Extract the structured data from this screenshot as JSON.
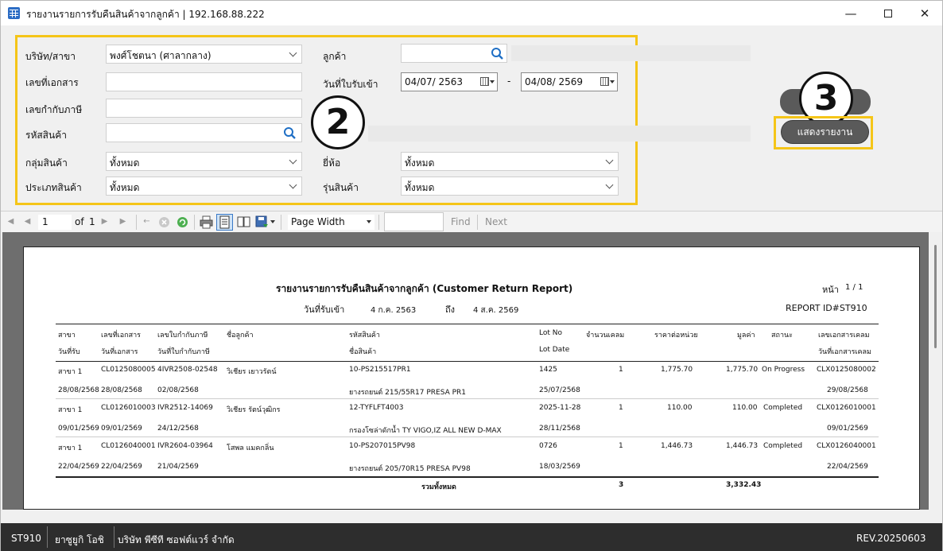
{
  "window": {
    "title": "รายงานรายการรับคืนสินค้าจากลูกค้า | 192.168.88.222"
  },
  "form": {
    "company_label": "บริษัท/สาขา",
    "company_value": "พงศ์โชตนา (ศาลากลาง)",
    "docno_label": "เลขที่เอกสาร",
    "docno_value": "",
    "taxno_label": "เลขกำกับภาษี",
    "taxno_value": "",
    "product_label": "รหัสสินค้า",
    "product_value": "",
    "group_label": "กลุ่มสินค้า",
    "group_value": "ทั้งหมด",
    "type_label": "ประเภทสินค้า",
    "type_value": "ทั้งหมด",
    "customer_label": "ลูกค้า",
    "customer_value": "",
    "date_label": "วันที่ใบรับเข้า",
    "date_from": "04/07/  2563",
    "date_sep": "-",
    "date_to": "04/08/  2569",
    "brand_label": "ยี่ห้อ",
    "brand_value": "ทั้งหมด",
    "model_label": "รุ่นสินค้า",
    "model_value": "ทั้งหมด",
    "show_report_label": "แสดงรายงาน"
  },
  "annotations": {
    "step2": "2",
    "step3": "3",
    "highlight_color": "#f5c518"
  },
  "toolbar": {
    "page_value": "1",
    "of_label": "of",
    "total_pages": "1",
    "zoom_value": "Page Width",
    "find_label": "Find",
    "next_label": "Next"
  },
  "report": {
    "title": "รายงานรายการรับคืนสินค้าจากลูกค้า (Customer Return Report)",
    "page_label": "หน้า",
    "page_value": "1 / 1",
    "date_label": "วันที่รับเข้า",
    "date_from": "4 ก.ค. 2563",
    "to_label": "ถึง",
    "date_to": "4 ส.ค. 2569",
    "report_id": "REPORT ID#ST910",
    "headers_row1": [
      "สาขา",
      "เลขที่เอกสาร",
      "เลขใบกำกับภาษี",
      "ชื่อลูกค้า",
      "รหัสสินค้า",
      "Lot No",
      "จำนวนเคลม",
      "ราคาต่อหน่วย",
      "มูลค่า",
      "สถานะ",
      "เลขเอกสารเคลม"
    ],
    "headers_row2": [
      "วันที่รับ",
      "วันที่เอกสาร",
      "วันที่ใบกำกับภาษี",
      "ชื่อสินค้า",
      "Lot Date",
      "วันที่เอกสารเคลม"
    ],
    "rows": [
      {
        "branch": "สาขา 1",
        "docno": "CL0125080005",
        "taxno": "4IVR2508-02548",
        "customer": "วิเชียร เยาวรัตน์",
        "product_code": "10-PS215517PR1",
        "lot_no": "1425",
        "qty": "1",
        "price": "1,775.70",
        "amount": "1,775.70",
        "status": "On Progress",
        "claim_no": "CLX0125080002",
        "recv_date": "28/08/2568",
        "doc_date": "28/08/2568",
        "tax_date": "02/08/2568",
        "product_name": "ยางรถยนต์ 215/55R17 PRESA PR1",
        "lot_date": "25/07/2568",
        "claim_date": "29/08/2568"
      },
      {
        "branch": "สาขา 1",
        "docno": "CL0126010003",
        "taxno": "IVR2512-14069",
        "customer": "วิเชียร รัตน์วุฒิกร",
        "product_code": "12-TYFLFT4003",
        "lot_no": "2025-11-28",
        "qty": "1",
        "price": "110.00",
        "amount": "110.00",
        "status": "Completed",
        "claim_no": "CLX0126010001",
        "recv_date": "09/01/2569",
        "doc_date": "09/01/2569",
        "tax_date": "24/12/2568",
        "product_name": "กรองโซล่าดักน้ำ TY VIGO,IZ ALL NEW D-MAX",
        "lot_date": "28/11/2568",
        "claim_date": "09/01/2569"
      },
      {
        "branch": "สาขา 1",
        "docno": "CL0126040001",
        "taxno": "IVR2604-03964",
        "customer": "โสพล แมคกลิ่น",
        "product_code": "10-PS207015PV98",
        "lot_no": "0726",
        "qty": "1",
        "price": "1,446.73",
        "amount": "1,446.73",
        "status": "Completed",
        "claim_no": "CLX0126040001",
        "recv_date": "22/04/2569",
        "doc_date": "22/04/2569",
        "tax_date": "21/04/2569",
        "product_name": "ยางรถยนต์ 205/70R15 PRESA PV98",
        "lot_date": "18/03/2569",
        "claim_date": "22/04/2569"
      }
    ],
    "total_label": "รวมทั้งหมด",
    "total_qty": "3",
    "total_amount": "3,332.43"
  },
  "status": {
    "code": "ST910",
    "user": "ยาซูยูกิ โอชิ",
    "company": "บริษัท พีซีที ซอฟต์แวร์ จำกัด",
    "rev": "REV.20250603"
  }
}
